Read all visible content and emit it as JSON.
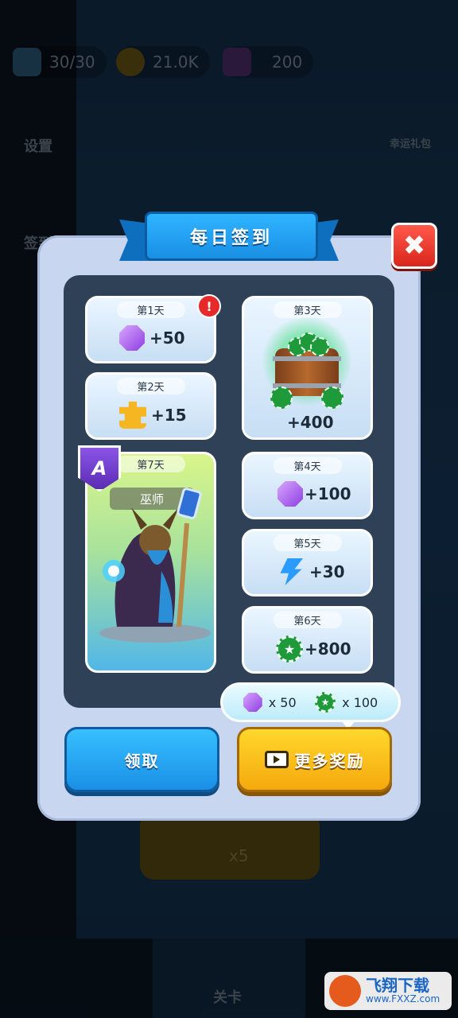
{
  "top_bar": {
    "energy": "30/30",
    "coins": "21.0K",
    "gems": "200"
  },
  "side_menu": {
    "settings_label": "设置",
    "checkin_label": "签到",
    "gift_label": "幸运礼包"
  },
  "bottom_nav": {
    "level_label": "关卡",
    "dim_button_value": "x5"
  },
  "dialog": {
    "title": "每日签到",
    "close_symbol": "✖",
    "alert_symbol": "!",
    "days": [
      {
        "label": "第1天",
        "value": "+50",
        "icon": "gem-icon"
      },
      {
        "label": "第2天",
        "value": "+15",
        "icon": "puzzle-icon"
      },
      {
        "label": "第3天",
        "value": "+400",
        "icon": "chip-barrel-icon"
      },
      {
        "label": "第4天",
        "value": "+100",
        "icon": "gem-icon"
      },
      {
        "label": "第5天",
        "value": "+30",
        "icon": "energy-bolt-icon"
      },
      {
        "label": "第6天",
        "value": "+800",
        "icon": "chip-icon"
      },
      {
        "label": "第7天",
        "hero_name": "巫师",
        "rank": "A",
        "icon": "wizard-hero"
      }
    ],
    "bonus": {
      "gem_value": "x 50",
      "chip_value": "x 100"
    },
    "claim_button": "领取",
    "more_button": "更多奖励"
  },
  "watermark": {
    "title": "飞翔下载",
    "url": "www.FXXZ.com"
  },
  "colors": {
    "dialog_bg": "#c9d6f0",
    "inner_bg": "#2e4156",
    "claim_blue": "#1a8fe6",
    "more_yellow": "#f5a90e",
    "close_red": "#d9261d"
  }
}
